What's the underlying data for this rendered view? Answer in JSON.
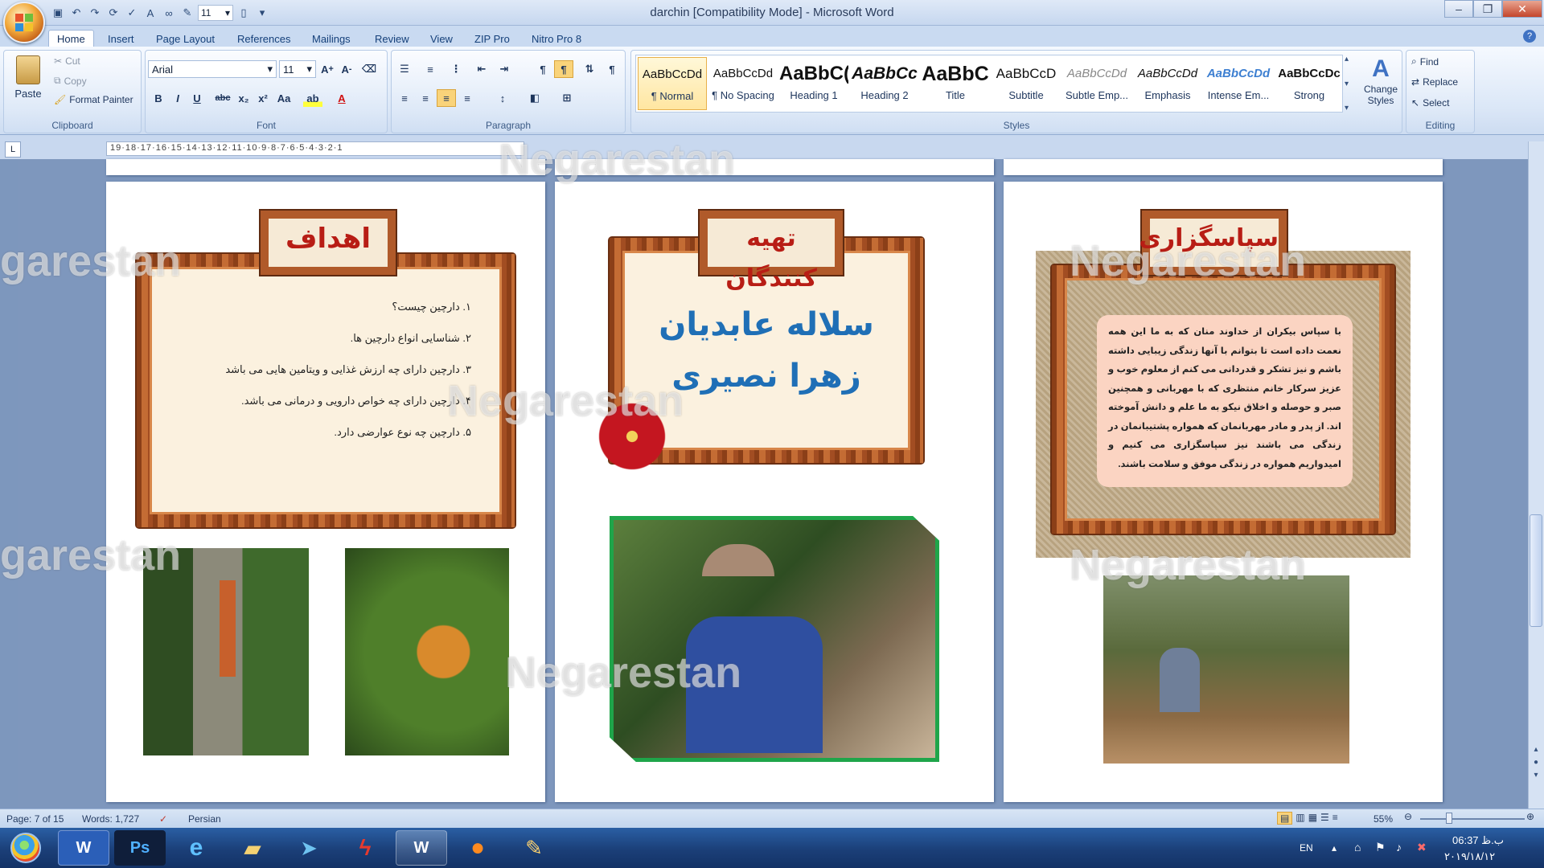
{
  "window": {
    "title": "darchin [Compatibility Mode] - Microsoft Word",
    "font_size_qat": "11"
  },
  "tabs": [
    "Home",
    "Insert",
    "Page Layout",
    "References",
    "Mailings",
    "Review",
    "View",
    "ZIP Pro",
    "Nitro Pro 8"
  ],
  "clipboard": {
    "paste": "Paste",
    "cut": "Cut",
    "copy": "Copy",
    "format_painter": "Format Painter",
    "label": "Clipboard"
  },
  "font": {
    "name": "Arial",
    "size": "11",
    "label": "Font"
  },
  "paragraph": {
    "label": "Paragraph"
  },
  "styles": {
    "label": "Styles",
    "change": "Change Styles",
    "items": [
      {
        "preview": "AaBbCcDd",
        "name": "¶ Normal"
      },
      {
        "preview": "AaBbCcDd",
        "name": "¶ No Spacing"
      },
      {
        "preview": "AaBbC(",
        "name": "Heading 1"
      },
      {
        "preview": "AaBbCc",
        "name": "Heading 2"
      },
      {
        "preview": "AaBbC",
        "name": "Title"
      },
      {
        "preview": "AaBbCcD",
        "name": "Subtitle"
      },
      {
        "preview": "AaBbCcDd",
        "name": "Subtle Emp..."
      },
      {
        "preview": "AaBbCcDd",
        "name": "Emphasis"
      },
      {
        "preview": "AaBbCcDd",
        "name": "Intense Em..."
      },
      {
        "preview": "AaBbCcDc",
        "name": "Strong"
      }
    ]
  },
  "editing": {
    "find": "Find",
    "replace": "Replace",
    "select": "Select",
    "label": "Editing"
  },
  "ruler": "19·18·17·16·15·14·13·12·11·10·9·8·7·6·5·4·3·2·1",
  "page1": {
    "title": "اهداف",
    "items": [
      "۱. دارچین چیست؟",
      "۲. شناسایی انواع دارچین ها.",
      "۳. دارچین دارای چه ارزش غذایی و ویتامین هایی می باشد",
      "۴. دارچین دارای چه خواص دارویی و درمانی می باشد.",
      "۵. دارچین چه نوع عوارضی دارد."
    ]
  },
  "page2": {
    "title": "تهیه کنندگان",
    "names": [
      "سلاله عابدیان",
      "زهرا نصیری"
    ]
  },
  "page3": {
    "title": "سپاسگزاری",
    "body": "با سپاس بیکران از خداوند منان که به ما این همه نعمت داده است تا بتوانم با آنها زندگی زیبایی داشته باشم و نیز تشکر و قدردانی می کنم از معلوم خوب و عزیز سرکار خانم منتظری که با مهربانی و همچنین صبر و حوصله و اخلاق نیکو به ما علم و دانش آموخته اند. از پدر و مادر مهربانمان که همواره پشتیبانمان در زندگی می باشند نیز سپاسگزاری می کنیم و امیدواریم همواره در زندگی موفق و سلامت باشند."
  },
  "watermark": "Negarestan",
  "watermark_partial": "garestan",
  "status": {
    "page": "Page: 7 of 15",
    "words": "Words: 1,727",
    "language": "Persian",
    "zoom": "55%"
  },
  "taskbar": {
    "lang": "EN",
    "time": "06:37 ب.ظ",
    "date": "۲۰۱۹/۱۸/۱۲"
  }
}
